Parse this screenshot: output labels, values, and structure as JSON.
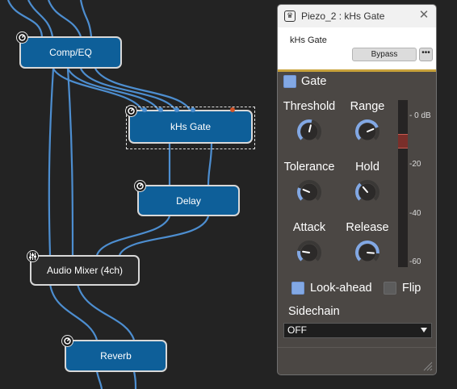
{
  "graph": {
    "nodes": {
      "comp_eq": "Comp/EQ",
      "khs_gate": "kHs Gate",
      "delay": "Delay",
      "audio_mixer": "Audio Mixer (4ch)",
      "reverb": "Reverb"
    }
  },
  "panel": {
    "title": "Piezo_2 : kHs Gate",
    "preset_name": "kHs Gate",
    "bypass_label": "Bypass",
    "more_label": "•••",
    "gate_label": "Gate",
    "gate_enabled": true,
    "controls": {
      "threshold": {
        "label": "Threshold",
        "level": 0.55
      },
      "range": {
        "label": "Range",
        "level": 0.75
      },
      "tolerance": {
        "label": "Tolerance",
        "level": 0.25
      },
      "hold": {
        "label": "Hold",
        "level": 0.35
      },
      "attack": {
        "label": "Attack",
        "level": 0.2
      },
      "release": {
        "label": "Release",
        "level": 0.85
      }
    },
    "meter": {
      "ticks": [
        "- 0 dB",
        "-20",
        "-40",
        "-60"
      ],
      "threshold_db": -12,
      "accent": "#7a2f2a"
    },
    "lookahead_label": "Look-ahead",
    "lookahead_enabled": true,
    "flip_label": "Flip",
    "flip_enabled": false,
    "sidechain_label": "Sidechain",
    "sidechain_value": "OFF"
  },
  "colors": {
    "node_blue": "#0e5f99",
    "wire": "#4d8ed0",
    "knob_accent": "#82a8e4",
    "panel_bg": "#4b4744",
    "gold": "#c8a23b"
  },
  "icons": {
    "node_badge": "dial-icon",
    "mixer_badge": "mixer-sliders-icon",
    "close": "close-icon",
    "logo": "app-logo-icon",
    "resize": "resize-grip-icon"
  }
}
